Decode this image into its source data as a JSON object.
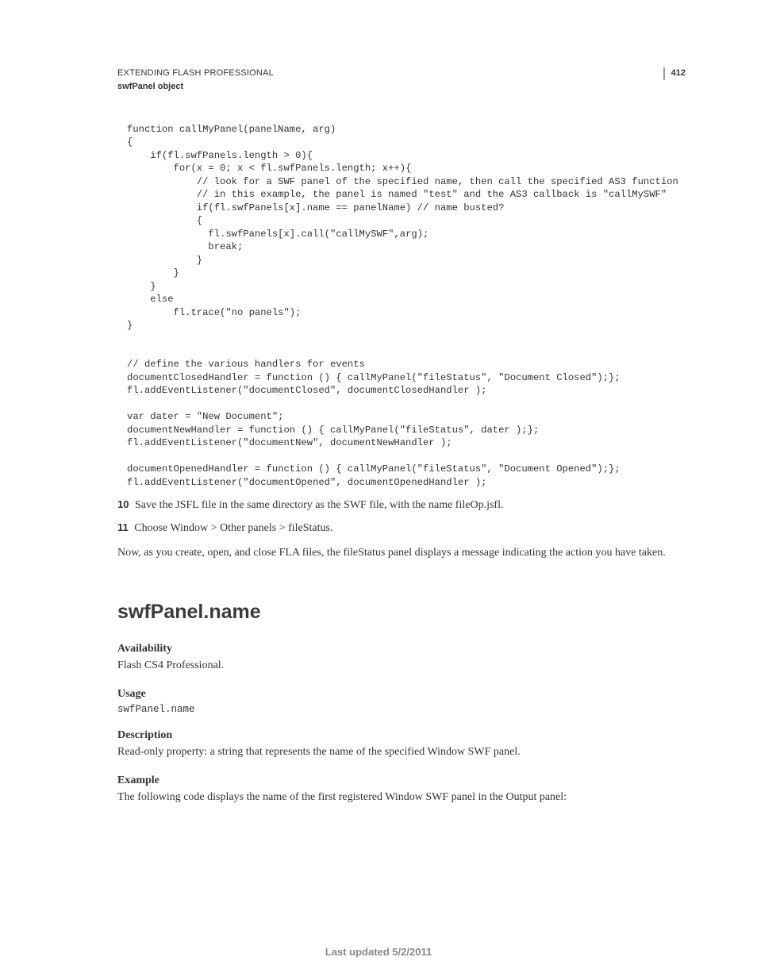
{
  "header": {
    "title": "EXTENDING FLASH PROFESSIONAL",
    "subtitle": "swfPanel object",
    "page_number": "412"
  },
  "code_block": "function callMyPanel(panelName, arg)\n{\n    if(fl.swfPanels.length > 0){\n        for(x = 0; x < fl.swfPanels.length; x++){\n            // look for a SWF panel of the specified name, then call the specified AS3 function\n            // in this example, the panel is named \"test\" and the AS3 callback is \"callMySWF\"\n            if(fl.swfPanels[x].name == panelName) // name busted?\n            {\n              fl.swfPanels[x].call(\"callMySWF\",arg);\n              break;\n            }\n        }\n    }\n    else\n        fl.trace(\"no panels\");\n}\n\n\n// define the various handlers for events\ndocumentClosedHandler = function () { callMyPanel(\"fileStatus\", \"Document Closed\");};\nfl.addEventListener(\"documentClosed\", documentClosedHandler );\n\nvar dater = \"New Document\";\ndocumentNewHandler = function () { callMyPanel(\"fileStatus\", dater );};\nfl.addEventListener(\"documentNew\", documentNewHandler );\n\ndocumentOpenedHandler = function () { callMyPanel(\"fileStatus\", \"Document Opened\");};\nfl.addEventListener(\"documentOpened\", documentOpenedHandler );",
  "steps": [
    {
      "num": "10",
      "text": "Save the JSFL file in the same directory as the SWF file, with the name fileOp.jsfl."
    },
    {
      "num": "11",
      "text": "Choose Window > Other panels > fileStatus."
    }
  ],
  "closing_para": "Now, as you create, open, and close FLA files, the fileStatus panel displays a message indicating the action you have taken.",
  "section": {
    "heading": "swfPanel.name",
    "availability_label": "Availability",
    "availability_text": "Flash CS4 Professional.",
    "usage_label": "Usage",
    "usage_code": "swfPanel.name",
    "description_label": "Description",
    "description_text": "Read-only property: a string that represents the name of the specified Window SWF panel.",
    "example_label": "Example",
    "example_text": "The following code displays the name of the first registered Window SWF panel in the Output panel:"
  },
  "footer": "Last updated 5/2/2011"
}
